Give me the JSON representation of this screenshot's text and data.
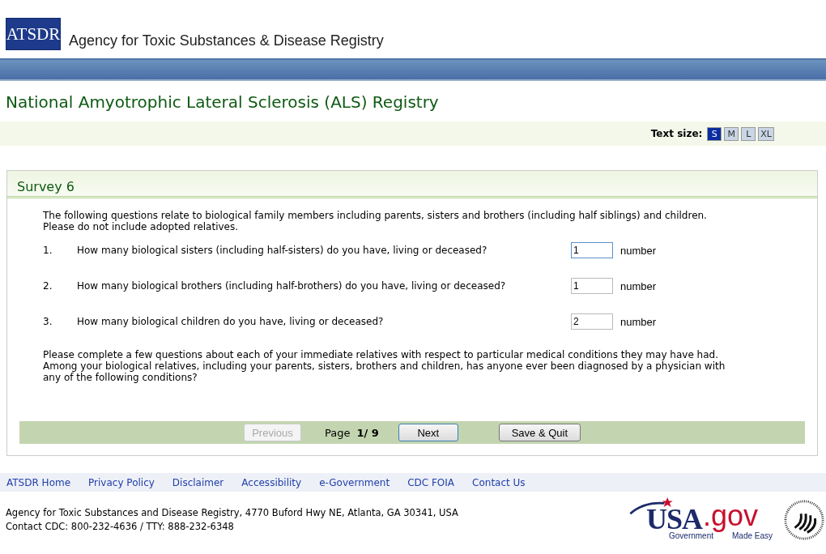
{
  "header": {
    "logo": "ATSDR",
    "agency": "Agency for Toxic Substances & Disease Registry"
  },
  "page_title": "National Amyotrophic Lateral Sclerosis (ALS) Registry",
  "text_size": {
    "label": "Text size:",
    "options": [
      {
        "label": "S",
        "selected": true
      },
      {
        "label": "M",
        "selected": false
      },
      {
        "label": "L",
        "selected": false
      },
      {
        "label": "XL",
        "selected": false
      }
    ]
  },
  "survey": {
    "title": "Survey 6",
    "intro": "The following questions relate to biological family members including parents, sisters and brothers (including half siblings) and children. Please do not include adopted relatives.",
    "questions": [
      {
        "number": "1.",
        "text": "How many biological sisters (including half-sisters) do you have, living or deceased?",
        "value": "1",
        "unit": "number",
        "focused": true
      },
      {
        "number": "2.",
        "text": "How many biological brothers (including half-brothers) do you have, living or deceased?",
        "value": "1",
        "unit": "number",
        "focused": false
      },
      {
        "number": "3.",
        "text": "How many biological children do you have, living or deceased?",
        "value": "2",
        "unit": "number",
        "focused": false
      }
    ],
    "outro": "Please complete a few questions about each of your immediate relatives with respect to particular medical conditions they may have had. Among your biological relatives, including your parents, sisters, brothers and children, has anyone ever been diagnosed by a physician with any of the following conditions?",
    "nav": {
      "previous": {
        "label": "Previous",
        "disabled": true
      },
      "page_label": "Page",
      "page_value": "1/ 9",
      "next": {
        "label": "Next",
        "disabled": false
      },
      "save": {
        "label": "Save & Quit",
        "disabled": false
      }
    }
  },
  "footer": {
    "links": [
      "ATSDR Home",
      "Privacy Policy",
      "Disclaimer",
      "Accessibility",
      "e-Government",
      "CDC FOIA",
      "Contact Us"
    ],
    "address": [
      "Agency for Toxic Substances and Disease Registry, 4770 Buford Hwy NE, Atlanta, GA 30341, USA",
      "Contact CDC: 800-232-4636 / TTY: 888-232-6348"
    ],
    "usagov": {
      "main": "USA",
      "tld": ".gov",
      "left": "Government",
      "right": "Made Easy"
    }
  }
}
